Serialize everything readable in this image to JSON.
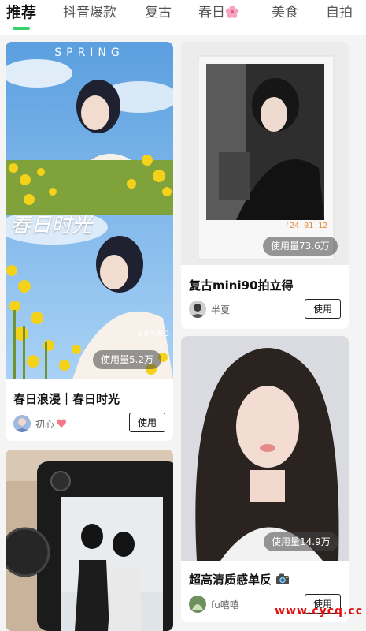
{
  "tabs": [
    {
      "label": "推荐",
      "active": true
    },
    {
      "label": "抖音爆款",
      "active": false
    },
    {
      "label": "复古",
      "active": false
    },
    {
      "label": "春日",
      "active": false,
      "icon": "sakura-icon"
    },
    {
      "label": "美食",
      "active": false
    },
    {
      "label": "自拍",
      "active": false
    }
  ],
  "accent_color": "#35d36a",
  "cards": [
    {
      "title": "春日浪漫｜春日时光",
      "usage": "使用量5.2万",
      "author": "初心",
      "author_icon": "heart-icon",
      "button": "使用",
      "cover_text": {
        "spring": "SPRING",
        "script": "春日时光",
        "spring_small": "SPRING"
      }
    },
    {
      "title": "复古mini90拍立得",
      "usage": "使用量73.6万",
      "author": "半夏",
      "button": "使用",
      "cover_text": {
        "date": "'24 01 12"
      }
    },
    {
      "title": "超高清质感单反",
      "title_icon": "camera-icon",
      "usage": "使用量14.9万",
      "author": "fu嘻嘻",
      "button": "使用"
    },
    {
      "title": "",
      "usage": "",
      "author": "",
      "button": ""
    }
  ],
  "watermark": "www.cycq.cc"
}
